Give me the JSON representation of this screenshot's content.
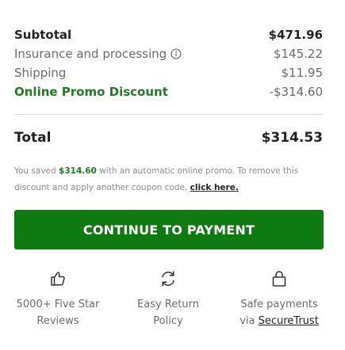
{
  "summary": {
    "subtotal_label": "Subtotal",
    "subtotal_value": "$471.96",
    "insurance_label": "Insurance and processing",
    "insurance_value": "$145.22",
    "shipping_label": "Shipping",
    "shipping_value": "$11.95",
    "promo_label": "Online Promo Discount",
    "promo_value": "-$314.60",
    "total_label": "Total",
    "total_value": "$314.53"
  },
  "note": {
    "prefix": "You saved ",
    "amount": "$314.60",
    "suffix": " with an automatic online promo. To remove this discount and apply another coupon code, ",
    "link": "click here."
  },
  "cta": {
    "label": "CONTINUE TO PAYMENT"
  },
  "features": {
    "reviews": {
      "icon": "thumbs-up-icon",
      "line1": "5000+ Five Star",
      "line2": "Reviews"
    },
    "returns": {
      "icon": "refresh-icon",
      "line1": "Easy Return",
      "line2": "Policy"
    },
    "payments": {
      "icon": "lock-icon",
      "line1": "Safe payments",
      "line2_prefix": "via ",
      "line2_link": "SecureTrust"
    }
  },
  "colors": {
    "accent_green": "#0f7a11",
    "promo_green": "#237a24",
    "muted_text": "#6b6b6b"
  }
}
